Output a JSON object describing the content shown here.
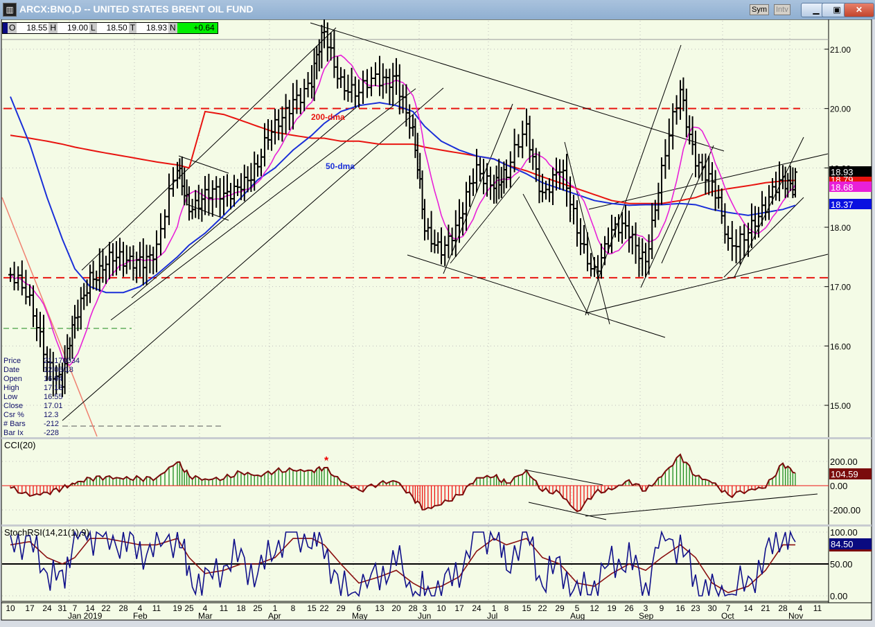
{
  "window": {
    "title": "ARCX:BNO,D -- UNITED STATES BRENT OIL FUND",
    "sym_label": "Sym",
    "intv_label": "Intv",
    "min": "▁",
    "max": "▣",
    "close": "✕"
  },
  "ohlc": {
    "o_label": "O",
    "o": "18.55",
    "h_label": "H",
    "h": "19.00",
    "l_label": "L",
    "l": "18.50",
    "t_label": "T",
    "t": "18.93",
    "n_label": "N",
    "n": "+0.64"
  },
  "info_panel": [
    [
      "Price",
      "21.170034"
    ],
    [
      "Date",
      "12/06/18"
    ],
    [
      "Open",
      "16.94"
    ],
    [
      "High",
      "17.13"
    ],
    [
      "Low",
      "16.55"
    ],
    [
      "Close",
      "17.01"
    ],
    [
      "Csr %",
      "12.3"
    ],
    [
      "# Bars",
      "-212"
    ],
    [
      "Bar Ix",
      "-228"
    ]
  ],
  "colors": {
    "bg": "#f4fbe6",
    "ma200": "#e8130f",
    "ma50": "#1a2fd8",
    "ma10": "#e820d8",
    "cci_pos": "#1a8a1a",
    "cci_neg": "#ee1010",
    "cci_line": "#7a0c0c",
    "stoch_fast": "#10108a",
    "stoch_slow": "#8a1010"
  },
  "chart_data": {
    "type": "line",
    "title": "ARCX:BNO,D -- UNITED STATES BRENT OIL FUND",
    "x_ticks": [
      "10",
      "17",
      "24",
      "31",
      "7",
      "14",
      "22",
      "28",
      "4",
      "11",
      "19",
      "25",
      "4",
      "11",
      "18",
      "25",
      "1",
      "8",
      "15",
      "22",
      "29",
      "6",
      "13",
      "20",
      "28",
      "3",
      "10",
      "17",
      "24",
      "1",
      "8",
      "15",
      "22",
      "29",
      "5",
      "12",
      "19",
      "26",
      "3",
      "9",
      "16",
      "23",
      "30",
      "7",
      "14",
      "21",
      "28",
      "4",
      "11"
    ],
    "month_labels": [
      [
        "Jan 2019",
        4
      ],
      [
        "Feb",
        8
      ],
      [
        "Mar",
        12
      ],
      [
        "Apr",
        16
      ],
      [
        "May",
        21
      ],
      [
        "Jun",
        25
      ],
      [
        "Jul",
        29
      ],
      [
        "Aug",
        34
      ],
      [
        "Sep",
        38
      ],
      [
        "Oct",
        43
      ],
      [
        "Nov",
        47
      ]
    ],
    "price_ticks": [
      "21.00",
      "20.00",
      "19.00",
      "18.00",
      "17.00",
      "16.00",
      "15.00"
    ],
    "ylim": [
      14.5,
      21.7
    ],
    "weekly_close": [
      17.2,
      16.6,
      15.9,
      15.4,
      16.3,
      17.3,
      17.4,
      17.3,
      17.6,
      17.6,
      18.9,
      18.5,
      18.5,
      18.4,
      18.9,
      19.0,
      19.6,
      20.3,
      20.4,
      21.2,
      20.6,
      20.2,
      20.4,
      20.7,
      19.5,
      17.9,
      17.8,
      18.0,
      18.9,
      18.9,
      18.8,
      19.6,
      18.7,
      18.9,
      17.9,
      17.4,
      17.8,
      17.9,
      17.6,
      18.8,
      20.3,
      19.3,
      18.6,
      17.7,
      18.1,
      18.2,
      18.8,
      18.93
    ],
    "ma200": [
      19.55,
      19.5,
      19.45,
      19.4,
      19.35,
      19.3,
      19.25,
      19.2,
      19.15,
      19.1,
      19.05,
      19.0,
      19.95,
      19.9,
      19.8,
      19.7,
      19.6,
      19.55,
      19.5,
      19.5,
      19.45,
      19.45,
      19.4,
      19.4,
      19.4,
      19.35,
      19.3,
      19.25,
      19.2,
      19.15,
      19.05,
      18.95,
      18.85,
      18.75,
      18.65,
      18.55,
      18.45,
      18.4,
      18.4,
      18.4,
      18.45,
      18.5,
      18.6,
      18.65,
      18.7,
      18.75,
      18.78,
      18.79
    ],
    "ma50": [
      20.2,
      19.4,
      18.5,
      17.8,
      17.3,
      17.0,
      16.9,
      16.9,
      17.0,
      17.2,
      17.5,
      17.7,
      17.9,
      18.2,
      18.5,
      18.8,
      19.0,
      19.3,
      19.55,
      19.75,
      19.95,
      20.05,
      20.1,
      20.05,
      19.95,
      19.7,
      19.45,
      19.3,
      19.2,
      19.15,
      19.05,
      18.9,
      18.75,
      18.65,
      18.55,
      18.45,
      18.4,
      18.37,
      18.38,
      18.38,
      18.4,
      18.38,
      18.3,
      18.25,
      18.2,
      18.25,
      18.3,
      18.37
    ],
    "cci": [
      -20,
      -80,
      -60,
      -20,
      20,
      60,
      70,
      60,
      60,
      60,
      200,
      80,
      50,
      60,
      110,
      80,
      120,
      130,
      120,
      150,
      40,
      -40,
      20,
      40,
      -100,
      -200,
      -150,
      -80,
      60,
      80,
      20,
      120,
      -40,
      -60,
      -220,
      -60,
      -30,
      40,
      -40,
      80,
      250,
      80,
      30,
      -80,
      -40,
      -10,
      180,
      104.59
    ],
    "stoch_fast": [
      95,
      80,
      40,
      20,
      100,
      100,
      90,
      85,
      70,
      75,
      100,
      30,
      20,
      50,
      60,
      30,
      80,
      100,
      90,
      80,
      5,
      10,
      30,
      60,
      0,
      5,
      10,
      40,
      100,
      100,
      50,
      100,
      20,
      50,
      0,
      20,
      50,
      60,
      10,
      100,
      80,
      20,
      5,
      0,
      20,
      60,
      100,
      84.5
    ],
    "stoch_slow": [
      80,
      85,
      60,
      50,
      60,
      90,
      90,
      85,
      80,
      80,
      90,
      60,
      35,
      40,
      50,
      50,
      60,
      90,
      90,
      80,
      50,
      20,
      30,
      40,
      20,
      10,
      15,
      30,
      70,
      90,
      80,
      90,
      60,
      50,
      20,
      15,
      35,
      50,
      40,
      60,
      80,
      60,
      20,
      5,
      15,
      40,
      80,
      80
    ],
    "support_lines": [
      20.0,
      17.15
    ],
    "annotations": {
      "ma200_label": "200-dma",
      "ma50_label": "50-dma",
      "cci_star": "*"
    },
    "last_values": {
      "close": "18.93",
      "ma200": "18.79",
      "ma10": "18.68",
      "ma50": "18.37",
      "cci": "104.59",
      "stoch": "84.50"
    },
    "cci_title": "CCI(20)",
    "cci_ticks": [
      "200.00",
      "0.00",
      "-200.00"
    ],
    "stoch_title": "StochRSI(14,21(1),9)",
    "stoch_ticks": [
      "100.00",
      "50.00",
      "0.00"
    ]
  }
}
